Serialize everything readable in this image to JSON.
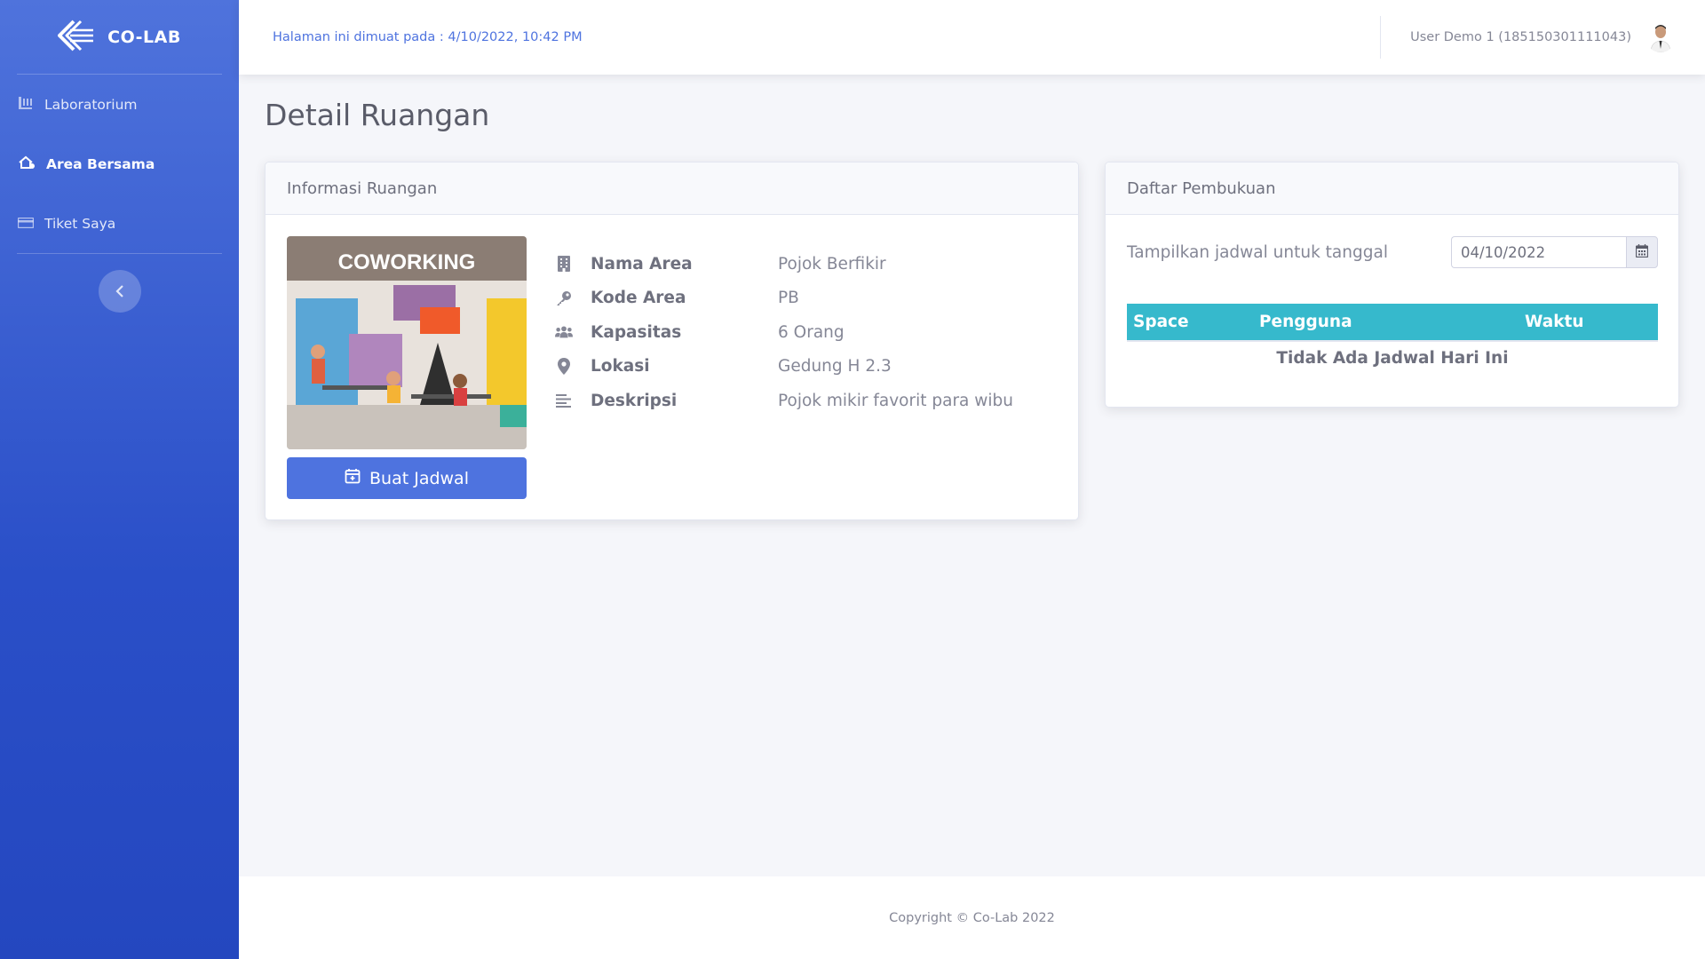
{
  "brand": {
    "name": "CO-LAB"
  },
  "sidebar": {
    "items": [
      {
        "label": "Laboratorium",
        "icon": "flask-icon",
        "active": false
      },
      {
        "label": "Area Bersama",
        "icon": "people-arrows-icon",
        "active": true
      },
      {
        "label": "Tiket Saya",
        "icon": "ticket-icon",
        "active": false
      }
    ],
    "toggle_icon": "chevron-left-icon"
  },
  "topbar": {
    "loaded_text": "Halaman ini dimuat pada : 4/10/2022, 10:42 PM",
    "user_name": "User Demo 1 (185150301111043)"
  },
  "page": {
    "title": "Detail Ruangan"
  },
  "info_card": {
    "header": "Informasi Ruangan",
    "image_caption": "COWORKING",
    "button_label": "Buat Jadwal",
    "fields": [
      {
        "label": "Nama Area",
        "value": "Pojok Berfikir",
        "icon": "building-icon"
      },
      {
        "label": "Kode Area",
        "value": "PB",
        "icon": "key-icon"
      },
      {
        "label": "Kapasitas",
        "value": "6 Orang",
        "icon": "users-icon"
      },
      {
        "label": "Lokasi",
        "value": "Gedung H 2.3",
        "icon": "map-marker-icon"
      },
      {
        "label": "Deskripsi",
        "value": "Pojok mikir favorit para wibu",
        "icon": "align-left-icon"
      }
    ]
  },
  "booking_card": {
    "header": "Daftar Pembukuan",
    "date_label": "Tampilkan jadwal untuk tanggal",
    "date_value": "04/10/2022",
    "columns": [
      "Space",
      "Pengguna",
      "Waktu"
    ],
    "empty_text": "Tidak Ada Jadwal Hari Ini"
  },
  "footer": {
    "text": "Copyright © Co-Lab 2022"
  },
  "colors": {
    "primary": "#4e73df",
    "info": "#36b9cc",
    "sidebar_dark": "#2447bf"
  }
}
